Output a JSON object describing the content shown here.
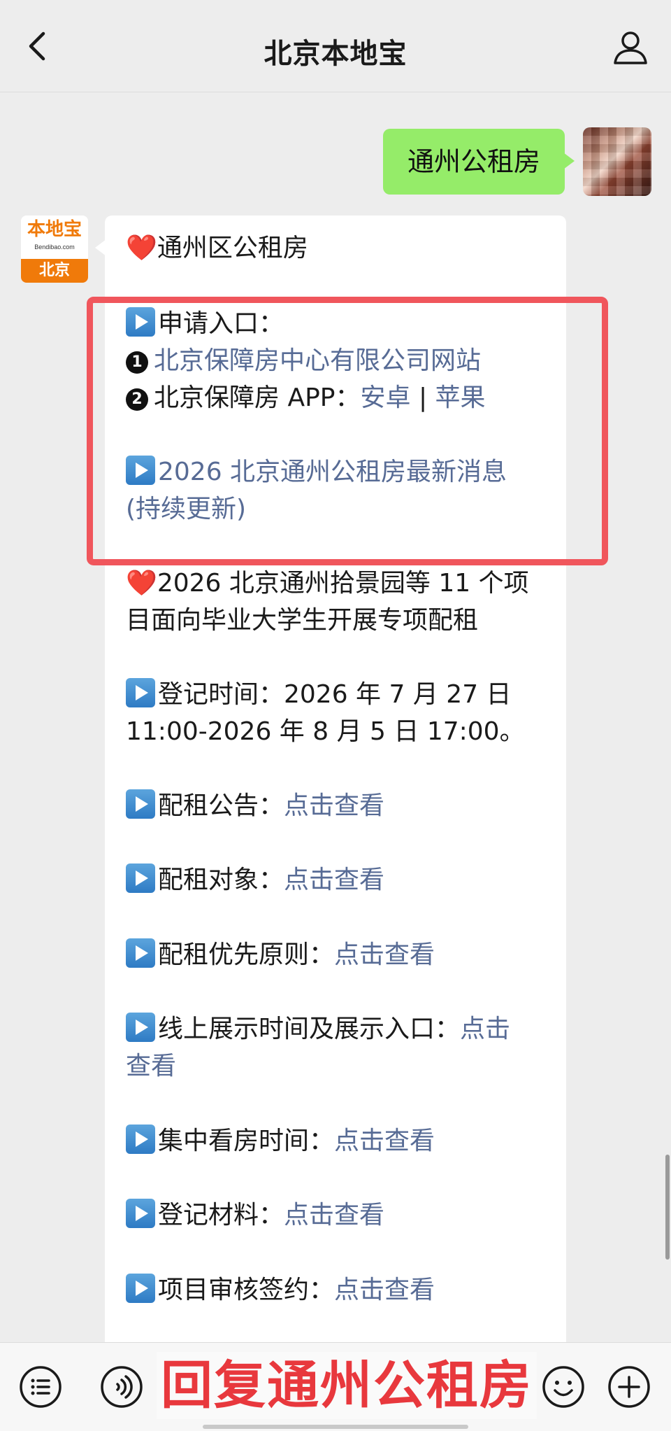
{
  "header": {
    "title": "北京本地宝"
  },
  "chat": {
    "sent_message": "通州公租房",
    "bot_logo": {
      "top": "本地宝",
      "sub": "Bendibao.com",
      "bottom": "北京"
    },
    "reply": {
      "heading": "❤️通州区公租房",
      "apply_entry": "申请入口：",
      "item1_link": "北京保障房中心有限公司网站",
      "item2_prefix": "北京保障房 APP：",
      "item2_android": "安卓",
      "item2_sep": " | ",
      "item2_ios": "苹果",
      "news_link_line1": "2026 北京通州公租房最新消息",
      "news_link_line2": "(持续更新)",
      "project_heading_line1": "❤️2026 北京通州拾景园等 11 个项",
      "project_heading_line2": "目面向毕业大学生开展专项配租",
      "reg_time_line1": "登记时间：2026 年 7 月 27 日",
      "reg_time_line2": "11:00-2026 年 8 月 5 日 17:00。",
      "rows": [
        {
          "label": "配租公告：",
          "link": "点击查看"
        },
        {
          "label": "配租对象：",
          "link": "点击查看"
        },
        {
          "label": "配租优先原则：",
          "link": "点击查看"
        },
        {
          "label": "线上展示时间及展示入口：",
          "link": "点击",
          "link2": "查看"
        },
        {
          "label": "集中看房时间：",
          "link": "点击查看"
        },
        {
          "label": "登记材料：",
          "link": "点击查看"
        },
        {
          "label": "项目审核签约：",
          "link": "点击查看"
        }
      ]
    }
  },
  "overlay": {
    "text": "回复通州公租房"
  },
  "colors": {
    "sent_bubble": "#95ec69",
    "link": "#576b95",
    "highlight": "#f0565c",
    "overlay_text": "#e8383d",
    "brand_orange": "#f07a0a"
  }
}
